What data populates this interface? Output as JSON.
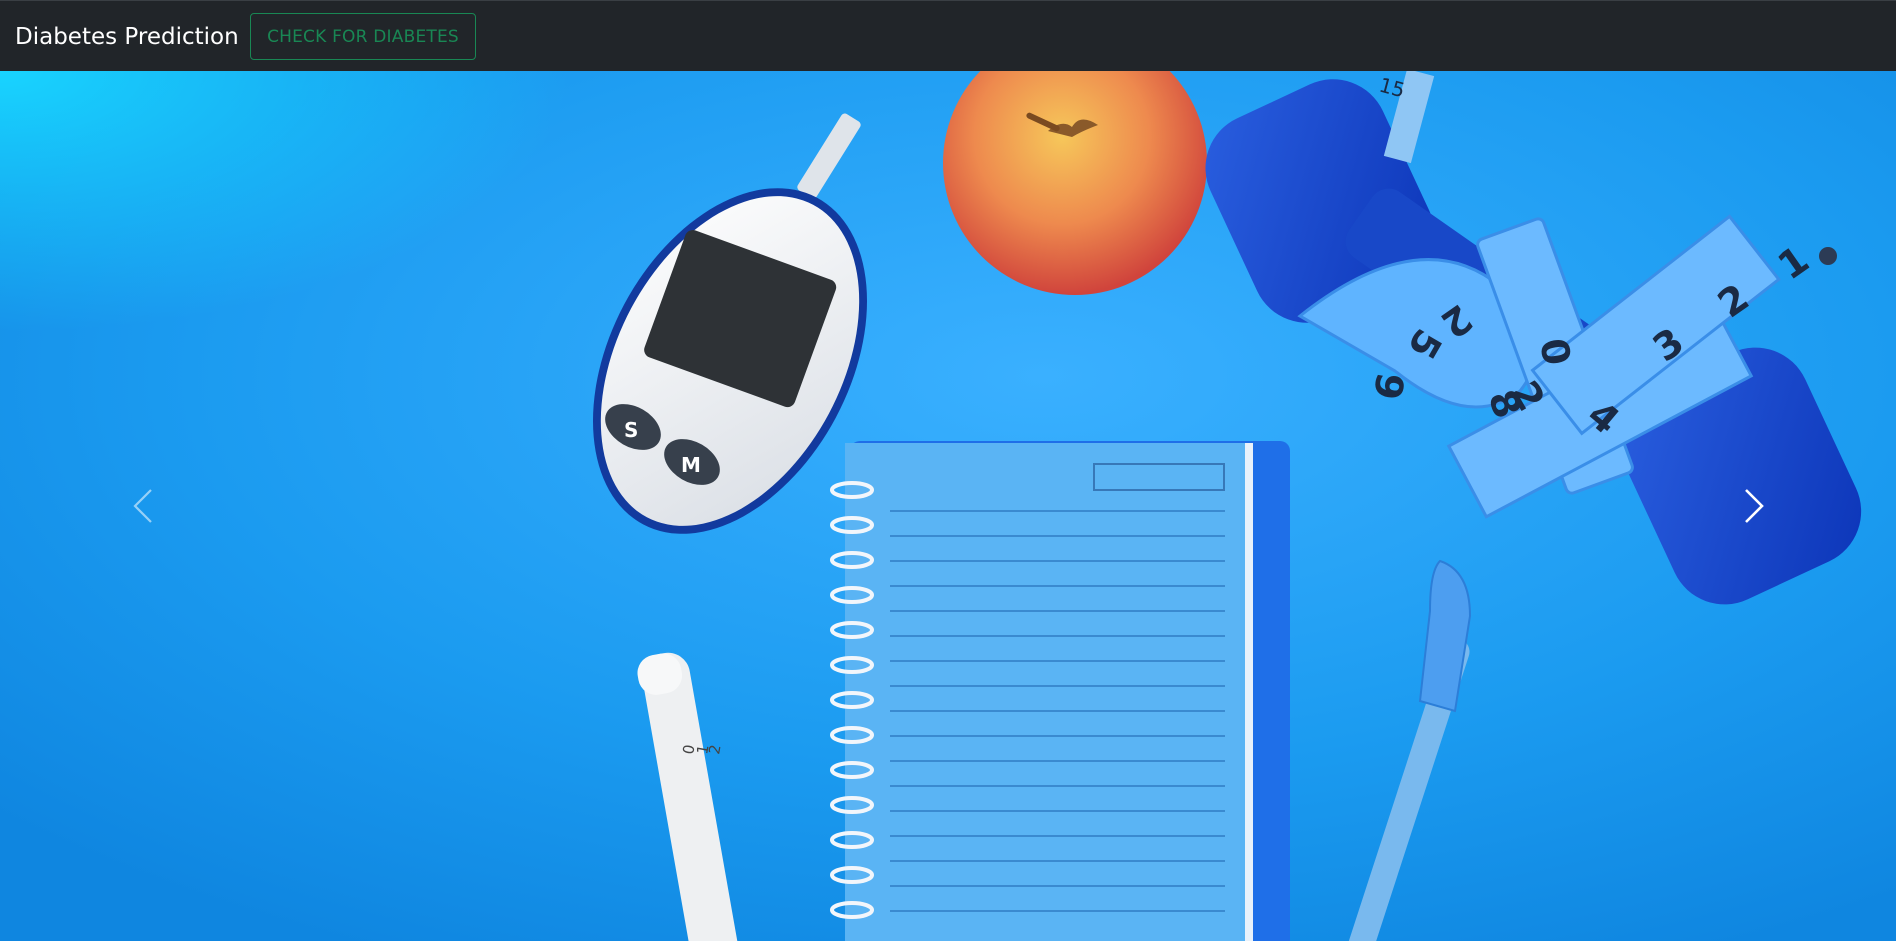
{
  "navbar": {
    "brand": "Diabetes Prediction",
    "check_button_label": "CHECK FOR DIABETES",
    "colors": {
      "background": "#212529",
      "button_outline": "#198754"
    }
  },
  "carousel": {
    "prev_icon": "chevron-left-icon",
    "next_icon": "chevron-right-icon",
    "slide": {
      "meter_buttons": [
        "S",
        "M"
      ],
      "tape_numbers": [
        "1",
        "2",
        "3",
        "4",
        "2",
        "0",
        "5",
        "2",
        "9",
        "8",
        "15"
      ],
      "lancet_numbers": [
        "0",
        "1",
        "2"
      ]
    }
  }
}
